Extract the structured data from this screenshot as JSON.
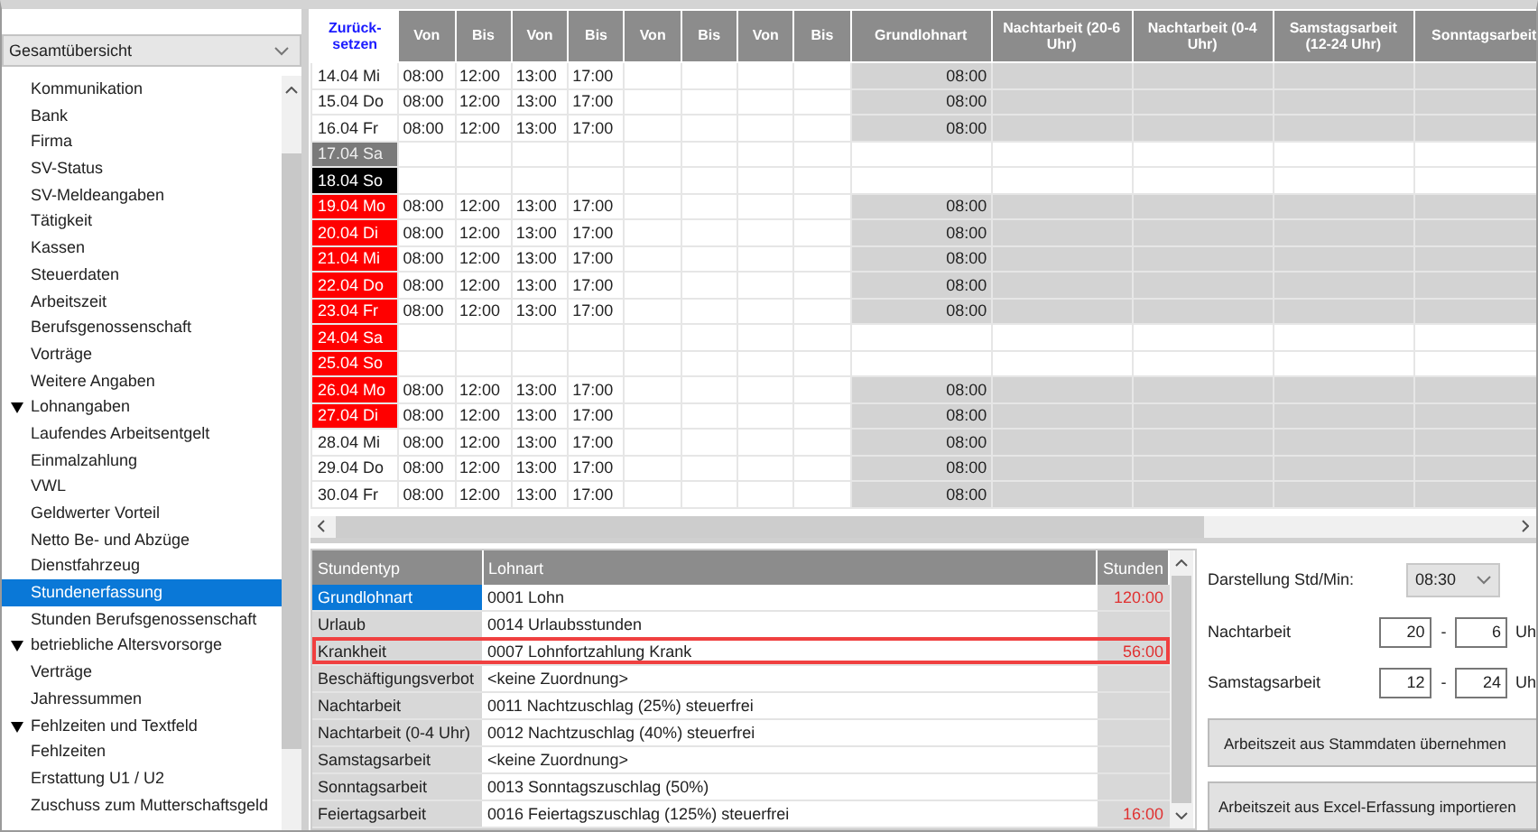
{
  "sidebar": {
    "dropdown": "Gesamtübersicht",
    "items": [
      {
        "label": "Kommunikation",
        "selected": false
      },
      {
        "label": "Bank",
        "selected": false
      },
      {
        "label": "Firma",
        "selected": false
      },
      {
        "label": "SV-Status",
        "selected": false
      },
      {
        "label": "SV-Meldeangaben",
        "selected": false
      },
      {
        "label": "Tätigkeit",
        "selected": false
      },
      {
        "label": "Kassen",
        "selected": false
      },
      {
        "label": "Steuerdaten",
        "selected": false
      },
      {
        "label": "Arbeitszeit",
        "selected": false
      },
      {
        "label": "Berufsgenossenschaft",
        "selected": false
      },
      {
        "label": "Vorträge",
        "selected": false
      },
      {
        "label": "Weitere Angaben",
        "selected": false
      },
      {
        "label": "Lohnangaben",
        "selected": false,
        "expanded": true,
        "children": [
          {
            "label": "Laufendes Arbeitsentgelt",
            "selected": false
          },
          {
            "label": "Einmalzahlung",
            "selected": false
          },
          {
            "label": "VWL",
            "selected": false
          },
          {
            "label": "Geldwerter Vorteil",
            "selected": false
          },
          {
            "label": "Netto Be- und Abzüge",
            "selected": false
          },
          {
            "label": "Dienstfahrzeug",
            "selected": false
          },
          {
            "label": "Stundenerfassung",
            "selected": true
          },
          {
            "label": "Stunden Berufsgenossenschaft",
            "selected": false
          }
        ]
      },
      {
        "label": "betriebliche Altersvorsorge",
        "selected": false,
        "expanded": true,
        "children": [
          {
            "label": "Verträge",
            "selected": false
          },
          {
            "label": "Jahressummen",
            "selected": false
          }
        ]
      },
      {
        "label": "Fehlzeiten und Textfeld",
        "selected": false,
        "expanded": true,
        "children": [
          {
            "label": "Fehlzeiten",
            "selected": false
          },
          {
            "label": "Erstattung U1 / U2",
            "selected": false
          },
          {
            "label": "Zuschuss zum Mutterschaftsgeld",
            "selected": false
          }
        ]
      }
    ]
  },
  "grid": {
    "reset": "Zurück-setzen",
    "columns": [
      "Von",
      "Bis",
      "Von",
      "Bis",
      "Von",
      "Bis",
      "Von",
      "Bis",
      "Grundlohnart",
      "Nachtarbeit (20-6 Uhr)",
      "Nachtarbeit (0-4 Uhr)",
      "Samstagsarbeit (12-24 Uhr)",
      "Sonntagsarbeit"
    ],
    "rows": [
      {
        "date": "14.04 Mi",
        "kind": "workday",
        "times": [
          "08:00",
          "12:00",
          "13:00",
          "17:00"
        ],
        "grundlohn": "08:00"
      },
      {
        "date": "15.04 Do",
        "kind": "workday",
        "times": [
          "08:00",
          "12:00",
          "13:00",
          "17:00"
        ],
        "grundlohn": "08:00"
      },
      {
        "date": "16.04 Fr",
        "kind": "workday",
        "times": [
          "08:00",
          "12:00",
          "13:00",
          "17:00"
        ],
        "grundlohn": "08:00"
      },
      {
        "date": "17.04 Sa",
        "kind": "saturday",
        "times": []
      },
      {
        "date": "18.04 So",
        "kind": "sunday",
        "times": []
      },
      {
        "date": "19.04 Mo",
        "kind": "sick",
        "times": [
          "08:00",
          "12:00",
          "13:00",
          "17:00"
        ],
        "grundlohn": "08:00"
      },
      {
        "date": "20.04 Di",
        "kind": "sick",
        "times": [
          "08:00",
          "12:00",
          "13:00",
          "17:00"
        ],
        "grundlohn": "08:00"
      },
      {
        "date": "21.04 Mi",
        "kind": "sick",
        "times": [
          "08:00",
          "12:00",
          "13:00",
          "17:00"
        ],
        "grundlohn": "08:00"
      },
      {
        "date": "22.04 Do",
        "kind": "sick",
        "times": [
          "08:00",
          "12:00",
          "13:00",
          "17:00"
        ],
        "grundlohn": "08:00"
      },
      {
        "date": "23.04 Fr",
        "kind": "sick",
        "times": [
          "08:00",
          "12:00",
          "13:00",
          "17:00"
        ],
        "grundlohn": "08:00"
      },
      {
        "date": "24.04 Sa",
        "kind": "sick",
        "times": []
      },
      {
        "date": "25.04 So",
        "kind": "sick",
        "times": []
      },
      {
        "date": "26.04 Mo",
        "kind": "sick",
        "times": [
          "08:00",
          "12:00",
          "13:00",
          "17:00"
        ],
        "grundlohn": "08:00"
      },
      {
        "date": "27.04 Di",
        "kind": "sick",
        "times": [
          "08:00",
          "12:00",
          "13:00",
          "17:00"
        ],
        "grundlohn": "08:00"
      },
      {
        "date": "28.04 Mi",
        "kind": "workday",
        "times": [
          "08:00",
          "12:00",
          "13:00",
          "17:00"
        ],
        "grundlohn": "08:00"
      },
      {
        "date": "29.04 Do",
        "kind": "workday",
        "times": [
          "08:00",
          "12:00",
          "13:00",
          "17:00"
        ],
        "grundlohn": "08:00"
      },
      {
        "date": "30.04 Fr",
        "kind": "workday",
        "times": [
          "08:00",
          "12:00",
          "13:00",
          "17:00"
        ],
        "grundlohn": "08:00"
      }
    ]
  },
  "hours": {
    "columns": [
      "Stundentyp",
      "Lohnart",
      "Stunden"
    ],
    "rows": [
      {
        "type": "Grundlohnart",
        "lohnart": "0001 Lohn",
        "stunden": "120:00",
        "selected": true,
        "highlighted": false
      },
      {
        "type": "Urlaub",
        "lohnart": "0014 Urlaubsstunden",
        "selected": false,
        "highlighted": false
      },
      {
        "type": "Krankheit",
        "lohnart": "0007 Lohnfortzahlung Krank",
        "stunden": "56:00",
        "selected": false,
        "highlighted": true
      },
      {
        "type": "Beschäftigungsverbot",
        "lohnart": "<keine Zuordnung>",
        "selected": false,
        "highlighted": false
      },
      {
        "type": "Nachtarbeit",
        "lohnart": "0011 Nachtzuschlag (25%) steuerfrei",
        "selected": false,
        "highlighted": false
      },
      {
        "type": "Nachtarbeit (0-4 Uhr)",
        "lohnart": "0012 Nachtzuschlag (40%) steuerfrei",
        "selected": false,
        "highlighted": false
      },
      {
        "type": "Samstagsarbeit",
        "lohnart": "<keine Zuordnung>",
        "selected": false,
        "highlighted": false
      },
      {
        "type": "Sonntagsarbeit",
        "lohnart": "0013 Sonntagszuschlag (50%)",
        "selected": false,
        "highlighted": false
      },
      {
        "type": "Feiertagsarbeit",
        "lohnart": "0016 Feiertagszuschlag (125%) steuerfrei",
        "stunden": "16:00",
        "selected": false,
        "highlighted": false
      }
    ]
  },
  "settings": {
    "display_label": "Darstellung Std/Min:",
    "display_value": "08:30",
    "ranges": [
      {
        "label": "Nachtarbeit",
        "from": "20",
        "dash": "-",
        "to": "6",
        "unit": "Uh"
      },
      {
        "label": "Samstagsarbeit",
        "from": "12",
        "dash": "-",
        "to": "24",
        "unit": "Uh"
      }
    ],
    "buttons": [
      "Arbeitszeit aus Stammdaten übernehmen",
      "Arbeitszeit aus Excel-Erfassung importieren"
    ]
  }
}
